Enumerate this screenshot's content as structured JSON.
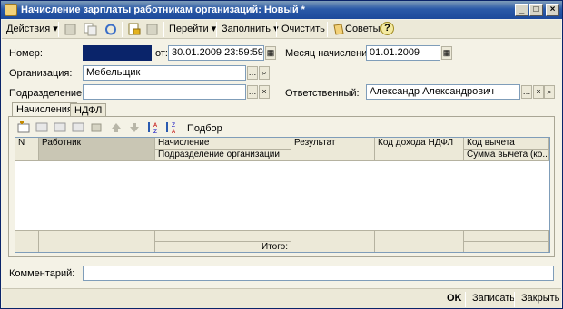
{
  "window": {
    "title": "Начисление зарплаты работникам организаций: Новый *"
  },
  "toolbar": {
    "actions_label": "Действия",
    "goto_label": "Перейти",
    "fill_label": "Заполнить",
    "clear_label": "Очистить",
    "tips_label": "Советы",
    "help_symbol": "?"
  },
  "form": {
    "number_label": "Номер:",
    "number_value": "",
    "from_label": "от:",
    "date_value": "30.01.2009 23:59:59",
    "month_label": "Месяц начисления:",
    "month_value": "01.01.2009",
    "org_label": "Организация:",
    "org_value": "Мебельщик",
    "dept_label": "Подразделение:",
    "dept_value": "",
    "resp_label": "Ответственный:",
    "resp_value": "Александр Александрович",
    "comment_label": "Комментарий:",
    "comment_value": ""
  },
  "tabs": [
    {
      "label": "Начисления"
    },
    {
      "label": "НДФЛ"
    }
  ],
  "table_toolbar": {
    "select_label": "Подбор"
  },
  "table": {
    "columns": {
      "num": "N",
      "worker": "Работник",
      "accrual": "Начисление",
      "dept": "Подразделение организации",
      "result": "Результат",
      "ndfl_code": "Код дохода НДФЛ",
      "deduction_code": "Код вычета",
      "deduction_sum": "Сумма вычета (ко..."
    },
    "footer_total_label": "Итого:"
  },
  "bottom": {
    "ok_label": "OK",
    "save_label": "Записать",
    "close_label": "Закрыть"
  }
}
